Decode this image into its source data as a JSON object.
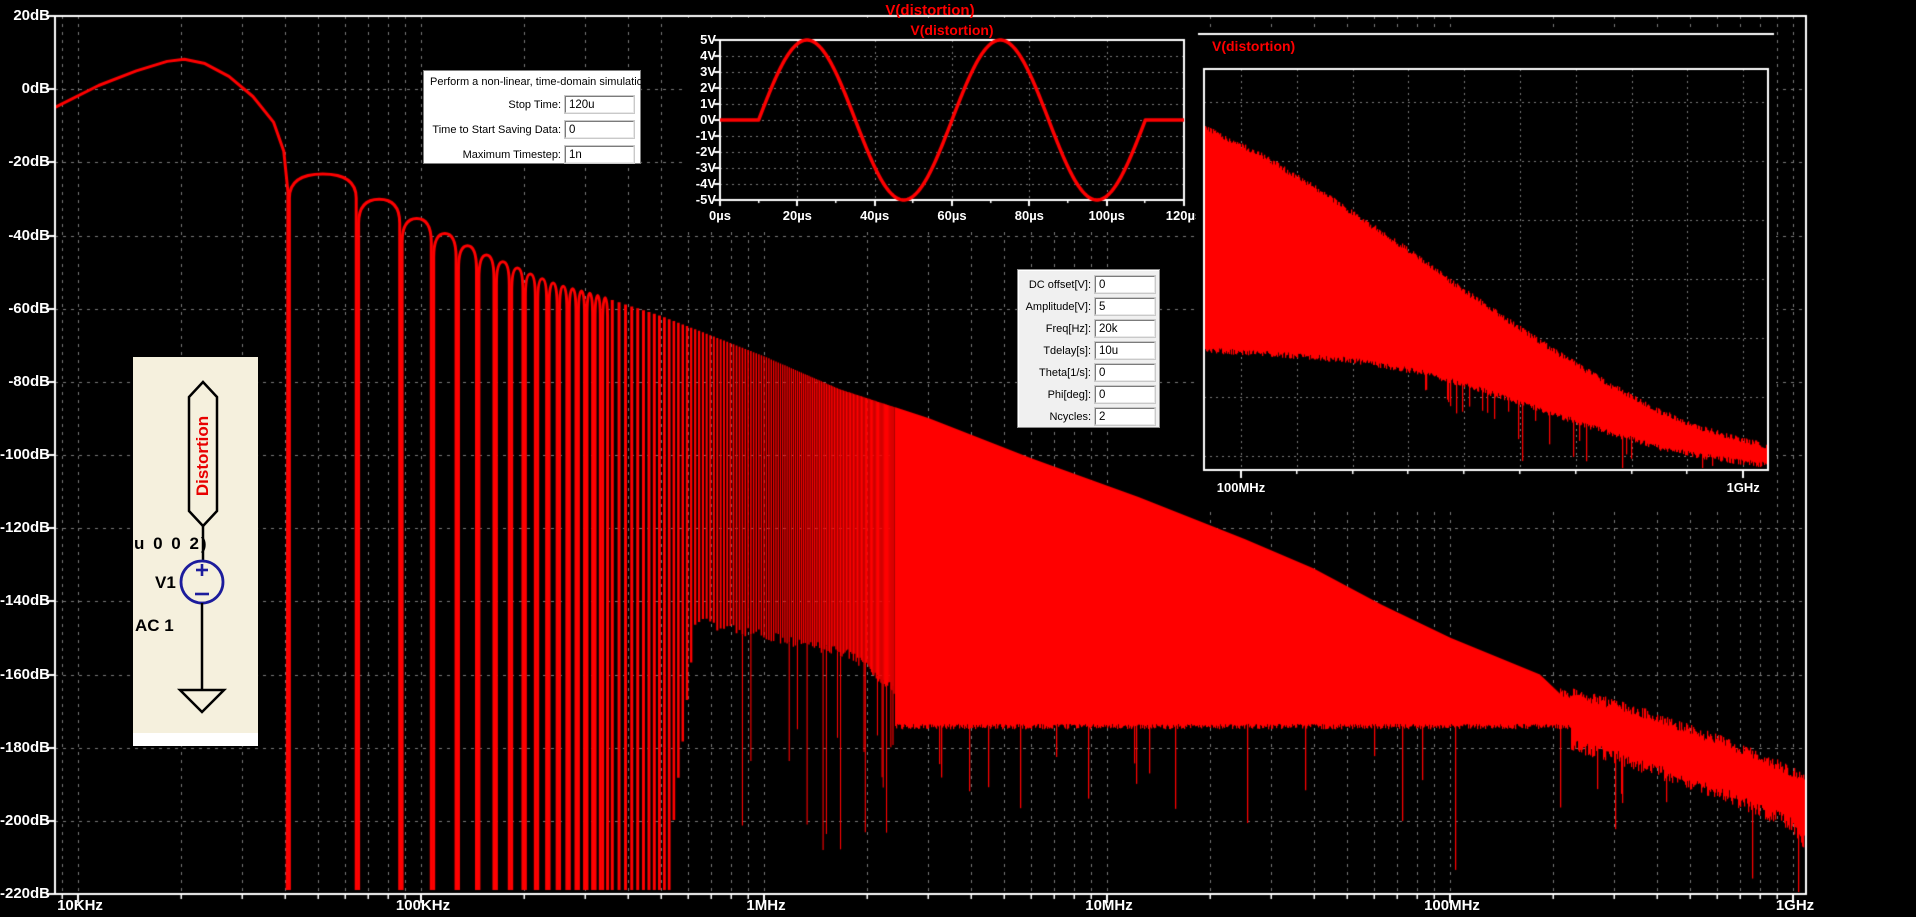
{
  "app": {
    "background": "#000000",
    "trace_color": "#ff0000",
    "grid_color": "#7a7a7a",
    "axis_color": "#ffffff"
  },
  "main_plot": {
    "title": "V(distortion)",
    "y_labels": [
      "20dB",
      "0dB",
      "-20dB",
      "-40dB",
      "-60dB",
      "-80dB",
      "-100dB",
      "-120dB",
      "-140dB",
      "-160dB",
      "-180dB",
      "-200dB",
      "-220dB"
    ],
    "x_labels": [
      "10KHz",
      "100KHz",
      "1MHz",
      "10MHz",
      "100MHz",
      "1GHz"
    ]
  },
  "inset_time": {
    "title": "V(distortion)",
    "y_labels": [
      "5V",
      "4V",
      "3V",
      "2V",
      "1V",
      "0V",
      "-1V",
      "-2V",
      "-3V",
      "-4V",
      "-5V"
    ],
    "x_labels": [
      "0µs",
      "20µs",
      "40µs",
      "60µs",
      "80µs",
      "100µs",
      "120µs"
    ]
  },
  "inset_fft": {
    "title": "V(distortion)",
    "x_labels": [
      "100MHz",
      "1GHz"
    ]
  },
  "chart_data": [
    {
      "id": "main_fft",
      "type": "line",
      "title": "V(distortion)",
      "x_axis": {
        "scale": "log",
        "tick_labels": [
          "10KHz",
          "100KHz",
          "1MHz",
          "10MHz",
          "100MHz",
          "1GHz"
        ],
        "range_hz": [
          8600,
          1100000000
        ]
      },
      "y_axis": {
        "unit": "dB",
        "range": [
          -220,
          20
        ],
        "grid_step_db": 20
      },
      "main_lobe_log10hz_db": [
        [
          3.933,
          -5
        ],
        [
          4.06,
          1
        ],
        [
          4.17,
          5
        ],
        [
          4.26,
          7.6
        ],
        [
          4.31,
          8.2
        ],
        [
          4.37,
          7
        ],
        [
          4.44,
          3.5
        ],
        [
          4.51,
          -2
        ],
        [
          4.57,
          -9
        ],
        [
          4.6,
          -17
        ],
        [
          4.612,
          -28
        ]
      ],
      "lobe_peak_envelope_log10hz_db": [
        [
          4.71,
          -23
        ],
        [
          4.9,
          -31
        ],
        [
          5.02,
          -37
        ],
        [
          5.1,
          -41
        ],
        [
          5.17,
          -44.5
        ],
        [
          5.26,
          -48
        ],
        [
          5.33,
          -51
        ],
        [
          5.4,
          -53.5
        ],
        [
          5.52,
          -56.5
        ],
        [
          5.7,
          -62
        ],
        [
          6.0,
          -73
        ],
        [
          6.22,
          -82
        ],
        [
          6.48,
          -90
        ],
        [
          6.78,
          -101
        ],
        [
          7.09,
          -111.5
        ],
        [
          7.4,
          -123
        ],
        [
          7.6,
          -131
        ],
        [
          7.8,
          -141
        ],
        [
          8.0,
          -150
        ],
        [
          8.26,
          -160
        ],
        [
          8.4,
          -172.5
        ],
        [
          9.05,
          -250
        ]
      ],
      "comb": {
        "first_null_hz": 41000,
        "final_spacing_hz": 16800,
        "extra_initial_spacing_hz": 10400,
        "spacing_decay": 3.0,
        "merge_hz": 2400000,
        "deep_bottom_until_hz": 530000
      },
      "bar_bottom_steps_log10hz_db": [
        [
          5.72,
          -213
        ],
        [
          5.8,
          -144
        ],
        [
          5.95,
          -147
        ],
        [
          6.1,
          -150
        ],
        [
          6.25,
          -153
        ],
        [
          6.38,
          -163
        ]
      ],
      "noise_floor_center_log10hz_db": [
        [
          6.38,
          -172.5
        ],
        [
          8.35,
          -172.5
        ],
        [
          8.5,
          -176
        ],
        [
          8.65,
          -181
        ],
        [
          8.8,
          -186
        ],
        [
          8.95,
          -192
        ],
        [
          9.04,
          -196
        ]
      ]
    },
    {
      "id": "time_wave",
      "type": "line",
      "title": "V(distortion)",
      "x_axis": {
        "unit": "µs",
        "range_us": [
          0,
          120
        ],
        "tick_labels": [
          "0µs",
          "20µs",
          "40µs",
          "60µs",
          "80µs",
          "100µs",
          "120µs"
        ]
      },
      "y_axis": {
        "unit": "V",
        "range": [
          -5,
          5
        ],
        "tick_labels": [
          "5V",
          "4V",
          "3V",
          "2V",
          "1V",
          "0V",
          "-1V",
          "-2V",
          "-3V",
          "-4V",
          "-5V"
        ]
      },
      "signal": {
        "shape": "delayed_sine_burst",
        "dc_offset_v": 0,
        "amplitude_v": 5,
        "freq_hz": 20000,
        "tdelay_us": 10,
        "ncycles": 2,
        "flat_after_us": 110,
        "t_end_us": 120
      }
    },
    {
      "id": "fft_zoom",
      "type": "area",
      "title": "V(distortion)",
      "x_axis": {
        "scale": "linear",
        "unit": "MHz",
        "range_mhz": [
          35,
          1043
        ],
        "grid_step_mhz": 100,
        "labeled_ticks_mhz": [
          100,
          1000
        ],
        "tick_labels": [
          "100MHz",
          "1GHz"
        ]
      },
      "y_axis": {
        "unit": "dB",
        "labels_visible": false
      },
      "band_top_mhz_frac": [
        [
          36,
          0.147
        ],
        [
          134,
          0.214
        ],
        [
          224,
          0.289
        ],
        [
          313,
          0.372
        ],
        [
          403,
          0.456
        ],
        [
          492,
          0.546
        ],
        [
          582,
          0.631
        ],
        [
          672,
          0.713
        ],
        [
          761,
          0.788
        ],
        [
          851,
          0.855
        ],
        [
          923,
          0.895
        ],
        [
          994,
          0.925
        ],
        [
          1043,
          0.94
        ]
      ],
      "band_bottom_mhz_frac": [
        [
          36,
          0.701
        ],
        [
          170,
          0.713
        ],
        [
          295,
          0.726
        ],
        [
          421,
          0.756
        ],
        [
          528,
          0.8
        ],
        [
          636,
          0.85
        ],
        [
          743,
          0.9
        ],
        [
          851,
          0.945
        ],
        [
          923,
          0.965
        ],
        [
          994,
          0.98
        ],
        [
          1043,
          0.988
        ]
      ]
    }
  ],
  "sim_dialog": {
    "title": "Perform a non-linear, time-domain simulation.",
    "fields": [
      {
        "label": "Stop Time:",
        "value": "120u"
      },
      {
        "label": "Time to Start Saving Data:",
        "value": "0"
      },
      {
        "label": "Maximum Timestep:",
        "value": "1n"
      }
    ]
  },
  "sine_dialog": {
    "fields": [
      {
        "label": "DC offset[V]:",
        "value": "0"
      },
      {
        "label": "Amplitude[V]:",
        "value": "5"
      },
      {
        "label": "Freq[Hz]:",
        "value": "20k"
      },
      {
        "label": "Tdelay[s]:",
        "value": "10u"
      },
      {
        "label": "Theta[1/s]:",
        "value": "0"
      },
      {
        "label": "Phi[deg]:",
        "value": "0"
      },
      {
        "label": "Ncycles:",
        "value": "2"
      }
    ]
  },
  "schematic": {
    "net_label": "Distortion",
    "partial_text": "u 0 0 2)",
    "designator": "V1",
    "value_text": "AC 1",
    "colors": {
      "background": "#f5f0dd",
      "symbol": "#1c1c9c",
      "wire": "#000000",
      "net_label": "#e80000"
    }
  }
}
